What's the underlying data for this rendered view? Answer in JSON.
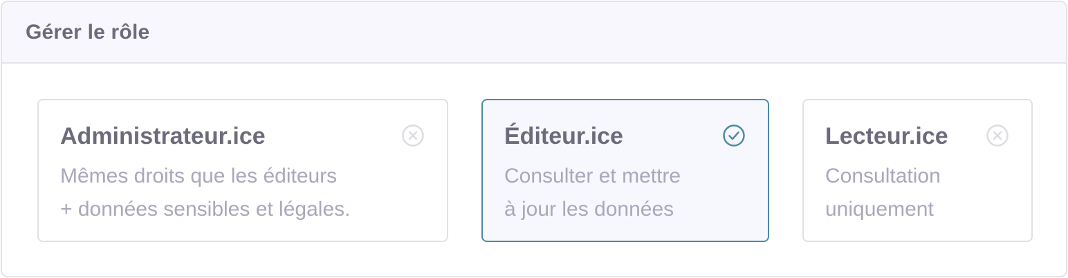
{
  "header": {
    "title": "Gérer le rôle"
  },
  "roles": [
    {
      "title": "Administrateur.ice",
      "description_lines": [
        "Mêmes droits que les éditeurs",
        "+ données sensibles et légales."
      ],
      "selected": false,
      "status_icon": "x-circle-icon"
    },
    {
      "title": "Éditeur.ice",
      "description_lines": [
        "Consulter et mettre",
        "à jour les données"
      ],
      "selected": true,
      "status_icon": "check-circle-icon"
    },
    {
      "title": "Lecteur.ice",
      "description_lines": [
        "Consultation",
        "uniquement"
      ],
      "selected": false,
      "status_icon": "x-circle-icon"
    }
  ],
  "colors": {
    "selected_border": "#4d8aa5",
    "selected_background": "#f7f8fe",
    "unselected_icon": "#dcdce3",
    "title_text": "#6c6b7b",
    "description_text": "#a9a8bb"
  }
}
